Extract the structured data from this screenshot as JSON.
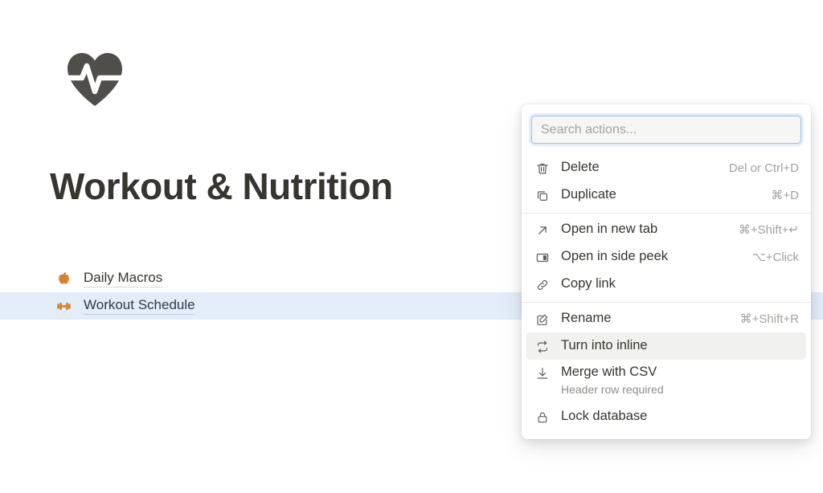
{
  "page": {
    "icon": "heart-pulse-icon",
    "icon_color": "#4f4e4b",
    "title": "Workout & Nutrition",
    "items": [
      {
        "icon": "apple-icon",
        "label": "Daily Macros",
        "selected": false
      },
      {
        "icon": "dumbbell-icon",
        "label": "Workout Schedule",
        "selected": true
      }
    ],
    "selected_row_color": "#e3edf9",
    "item_icon_color": "#d9822b"
  },
  "menu": {
    "search": {
      "placeholder": "Search actions...",
      "value": "",
      "focus_ring_color": "#9fc0e8"
    },
    "groups": [
      {
        "items": [
          {
            "icon": "trash-icon",
            "label": "Delete",
            "shortcut": "Del or Ctrl+D",
            "sub": "",
            "hovered": false
          },
          {
            "icon": "duplicate-icon",
            "label": "Duplicate",
            "shortcut": "⌘+D",
            "sub": "",
            "hovered": false
          }
        ]
      },
      {
        "items": [
          {
            "icon": "open-new-tab-icon",
            "label": "Open in new tab",
            "shortcut": "⌘+Shift+↵",
            "sub": "",
            "hovered": false
          },
          {
            "icon": "side-peek-icon",
            "label": "Open in side peek",
            "shortcut": "⌥+Click",
            "sub": "",
            "hovered": false
          },
          {
            "icon": "link-icon",
            "label": "Copy link",
            "shortcut": "",
            "sub": "",
            "hovered": false
          }
        ]
      },
      {
        "items": [
          {
            "icon": "rename-icon",
            "label": "Rename",
            "shortcut": "⌘+Shift+R",
            "sub": "",
            "hovered": false
          },
          {
            "icon": "turn-into-inline-icon",
            "label": "Turn into inline",
            "shortcut": "",
            "sub": "",
            "hovered": true
          },
          {
            "icon": "download-icon",
            "label": "Merge with CSV",
            "shortcut": "",
            "sub": "Header row required",
            "hovered": false
          },
          {
            "icon": "lock-icon",
            "label": "Lock database",
            "shortcut": "",
            "sub": "",
            "hovered": false
          }
        ]
      }
    ],
    "hover_background": "#f1f1ef"
  }
}
